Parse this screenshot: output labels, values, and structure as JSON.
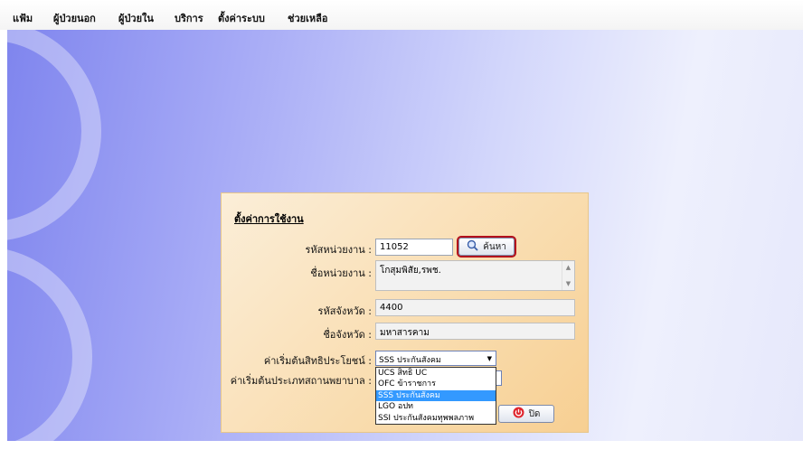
{
  "menu": [
    "แฟ้ม",
    "ผู้ป่วยนอก",
    "ผู้ป่วยใน",
    "บริการ",
    "ตั้งค่าระบบ",
    "ช่วยเหลือ"
  ],
  "panel": {
    "title": "ตั้งค่าการใช้งาน",
    "unit_code_label": "รหัสหน่วยงาน :",
    "unit_code_value": "11052",
    "search_button": "ค้นหา",
    "unit_name_label": "ชื่อหน่วยงาน :",
    "unit_name_value": "โกสุมพิสัย,รพช.",
    "province_code_label": "รหัสจังหวัด :",
    "province_code_value": "4400",
    "province_name_label": "ชื่อจังหวัด :",
    "province_name_value": "มหาสารคาม",
    "default_right_label": "ค่าเริ่มต้นสิทธิประโยชน์ :",
    "default_right_value": "SSS ประกันสังคม",
    "default_hospital_type_label": "ค่าเริ่มต้นประเภทสถานพยาบาล :",
    "close_button": "ปิด"
  },
  "dropdown": {
    "options": [
      "UCS สิทธิ UC",
      "OFC ข้าราชการ",
      "SSS ประกันสังคม",
      "LGO อปท",
      "SSI ประกันสังคมทุพพลภาพ"
    ],
    "selected": "SSS ประกันสังคม"
  },
  "colors": {
    "desktop_gradient_start": "#7f85ee",
    "panel_background": "#f9dcae",
    "highlight_outline": "#b3101c",
    "selection": "#3399ff"
  }
}
